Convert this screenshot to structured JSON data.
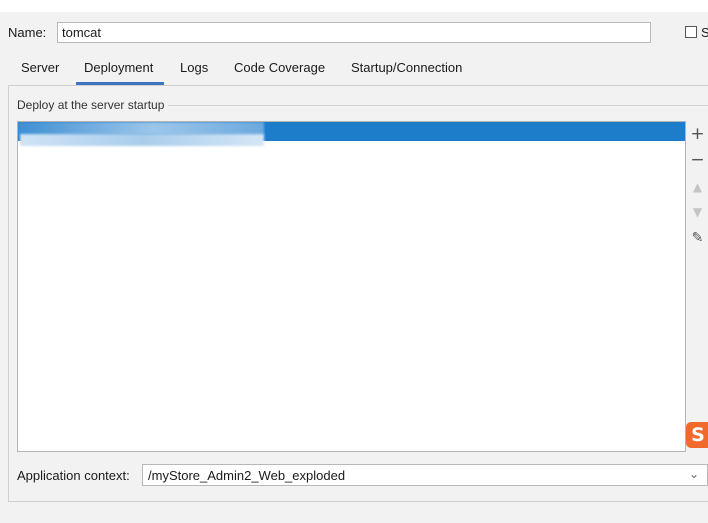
{
  "form": {
    "name_label": "Name:",
    "name_value": "tomcat",
    "share_label": "S"
  },
  "tabs": [
    {
      "label": "Server",
      "active": false
    },
    {
      "label": "Deployment",
      "active": true
    },
    {
      "label": "Logs",
      "active": false
    },
    {
      "label": "Code Coverage",
      "active": false
    },
    {
      "label": "Startup/Connection",
      "active": false
    }
  ],
  "deployment": {
    "section_title": "Deploy at the server startup",
    "selected_item_redacted": true,
    "toolbar": {
      "add_icon": "plus-icon",
      "remove_icon": "minus-icon",
      "move_up_icon": "arrow-up-icon",
      "move_down_icon": "arrow-down-icon",
      "edit_icon": "pencil-icon"
    },
    "context_label": "Application context:",
    "context_value": "/myStore_Admin2_Web_exploded"
  },
  "colors": {
    "accent": "#3d74bf",
    "selection": "#1e7dca",
    "watermark": "#ef6a2b"
  }
}
